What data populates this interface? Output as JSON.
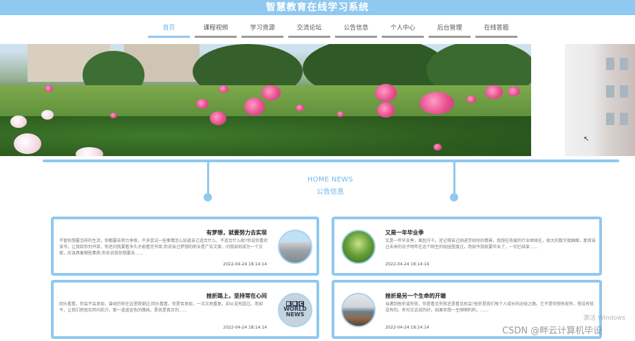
{
  "header": {
    "title": "智慧教育在线学习系统"
  },
  "nav": {
    "items": [
      {
        "label": "首页"
      },
      {
        "label": "课程视频"
      },
      {
        "label": "学习资源"
      },
      {
        "label": "交流论坛"
      },
      {
        "label": "公告信息"
      },
      {
        "label": "个人中心"
      },
      {
        "label": "后台管理"
      },
      {
        "label": "在线答题"
      }
    ],
    "active_index": 0
  },
  "section": {
    "title_en": "HOME NEWS",
    "title_zh": "公告信息"
  },
  "news": [
    {
      "title": "有梦想，就要努力去实现",
      "summary": "不管你想要怎样的生活，你都要去努力争取，不多尝试一些事情怎么知道自己适合什么、不适合什么呢?你说你喜欢读书，让我给你列书单，你还问我要看多久才能看完书单;你说自己梦想的职业是广告文案，问我如何成为一个文案，应该具备哪些素质;你告诉我你想要去……",
      "date": "2022-04-24 18:14:14",
      "thumb": "campus-building"
    },
    {
      "title": "又是一年毕业季",
      "summary": "又是一年毕业季，离愁万千。还记得自己刚进学校时的情景，我想在热爱的行业继续在，很大的数字接触面，那双自己未来的日子明年在这个陌生的校园里度过，而如今我就要毕业了，一切已结束……",
      "date": "2022-04-24 18:14:14",
      "thumb": "trees"
    },
    {
      "title": "挫折路上，坚持常在心间",
      "summary": "回头看看，你会不会发现，曾经的你在这里跌倒过;回头看看，你是否发现，一次次地重复，却从没有超过。而如今，让我们把现实转向前方，那一道道金色的路线，是否是真正的……",
      "date": "2022-04-24 18:14:14",
      "thumb": "bbc-world-news"
    },
    {
      "title": "挫折是另一个生命的开端",
      "summary": "当遇到挫折或失败，你是看见失败还是看见机会?挫折是我们每个人成长的必经之路，它不是你想有就有，想没有就没有的。有句古话说的好，如果你想一生顺顺利利，……",
      "date": "2022-04-24 18:14:14",
      "thumb": "classroom"
    }
  ],
  "bbc_logo": {
    "letters": [
      "B",
      "B",
      "C"
    ],
    "line1": "WORLD",
    "line2": "NEWS"
  },
  "watermark": "CSDN @畔云计算机毕设",
  "os_watermark": "激活 Windows",
  "colors": {
    "accent": "#8fc8f0",
    "nav_active": "#6fb5e8",
    "nav_underline": "#9a9a9a"
  }
}
